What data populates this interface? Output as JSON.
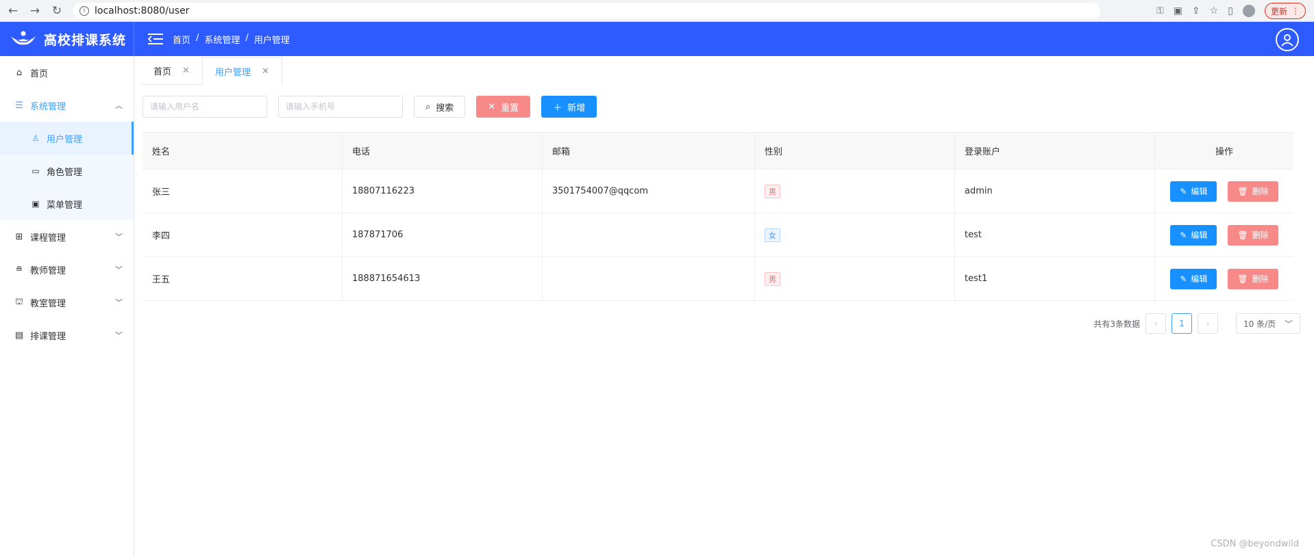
{
  "browser": {
    "url": "localhost:8080/user",
    "update_label": "更新"
  },
  "header": {
    "app_title": "高校排课系统",
    "breadcrumb": [
      "首页",
      "/",
      "系统管理",
      "/",
      "用户管理"
    ]
  },
  "sidebar": {
    "home": "首页",
    "system": "系统管理",
    "system_children": [
      "用户管理",
      "角色管理",
      "菜单管理"
    ],
    "course": "课程管理",
    "teacher": "教师管理",
    "classroom": "教室管理",
    "schedule": "排课管理"
  },
  "tabs": [
    "首页",
    "用户管理"
  ],
  "toolbar": {
    "username_placeholder": "请输入用户名",
    "phone_placeholder": "请输入手机号",
    "search_label": "搜索",
    "reset_label": "重置",
    "add_label": "新增"
  },
  "table": {
    "headers": [
      "姓名",
      "电话",
      "邮箱",
      "性别",
      "登录账户",
      "操作"
    ],
    "rows": [
      {
        "name": "张三",
        "phone": "18807116223",
        "email": "3501754007@qqcom",
        "gender": "男",
        "account": "admin"
      },
      {
        "name": "李四",
        "phone": "187871706",
        "email": "",
        "gender": "女",
        "account": "test"
      },
      {
        "name": "王五",
        "phone": "18887165461З",
        "email": "",
        "gender": "男",
        "account": "test1"
      }
    ],
    "edit_label": "编辑",
    "delete_label": "删除"
  },
  "pager": {
    "total": "共有3条数据",
    "current_page": "1",
    "page_size": "10 条/页"
  },
  "watermark": "CSDN @beyondwild"
}
